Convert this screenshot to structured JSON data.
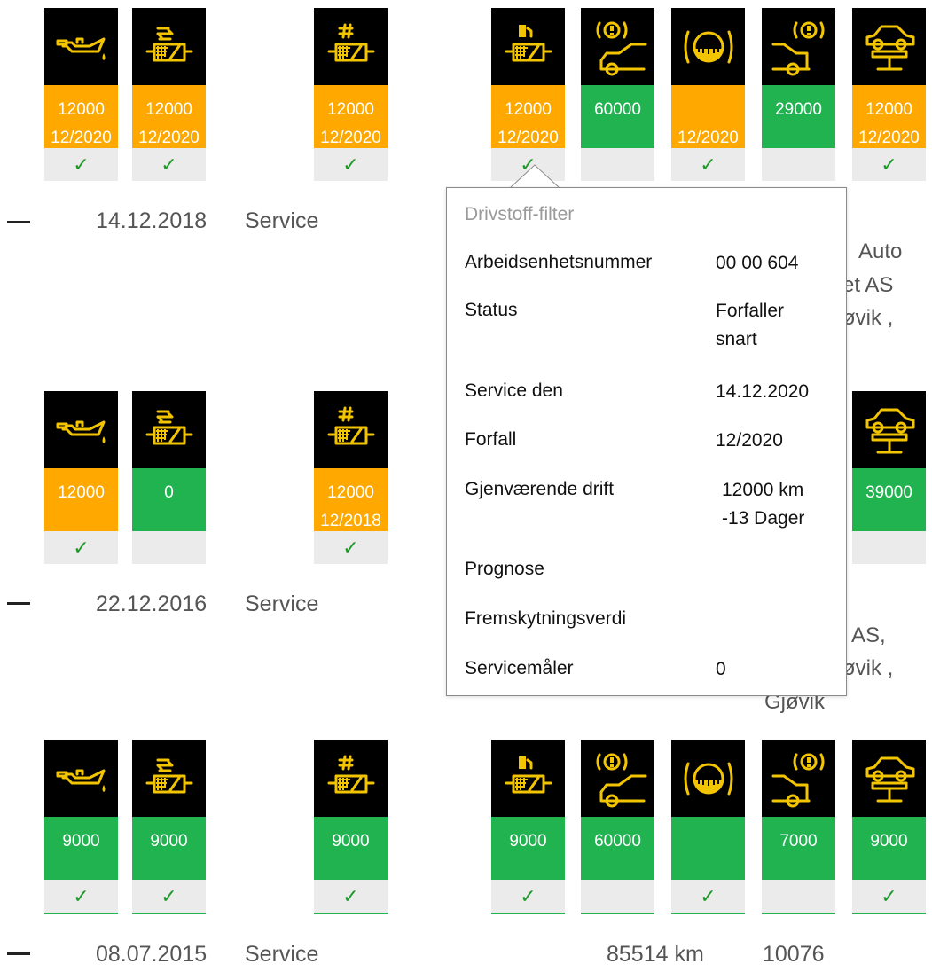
{
  "rows": [
    {
      "date": "14.12.2018",
      "type": "Service",
      "partial_text": [
        "Auto",
        "et AS",
        "øvik ,"
      ],
      "tiles": [
        {
          "icon": "oil-can-icon",
          "status_color": "orange",
          "lines": [
            "12000",
            "12/2020"
          ],
          "checked": true
        },
        {
          "icon": "air-filter-icon",
          "status_color": "orange",
          "lines": [
            "12000",
            "12/2020"
          ],
          "checked": true
        },
        {
          "icon": "pollen-filter-icon",
          "status_color": "orange",
          "lines": [
            "12000",
            "12/2020"
          ],
          "checked": true
        },
        {
          "icon": "fuel-filter-icon",
          "status_color": "orange",
          "lines": [
            "12000",
            "12/2020"
          ],
          "checked": true
        },
        {
          "icon": "front-brake-icon",
          "status_color": "green",
          "lines": [
            "60000",
            ""
          ],
          "checked": false
        },
        {
          "icon": "brake-fluid-icon",
          "status_color": "orange",
          "lines": [
            "",
            "12/2020"
          ],
          "checked": true
        },
        {
          "icon": "rear-brake-icon",
          "status_color": "green",
          "lines": [
            "29000",
            ""
          ],
          "checked": false
        },
        {
          "icon": "vehicle-check-icon",
          "status_color": "orange",
          "lines": [
            "12000",
            "12/2020"
          ],
          "checked": true
        }
      ]
    },
    {
      "date": "22.12.2016",
      "type": "Service",
      "partial_text": [
        "AS,",
        "øvik ,",
        "Gjøvik"
      ],
      "tiles": [
        {
          "icon": "oil-can-icon",
          "status_color": "orange",
          "lines": [
            "12000",
            ""
          ],
          "checked": true
        },
        {
          "icon": "air-filter-icon",
          "status_color": "green",
          "lines": [
            "0",
            ""
          ],
          "checked": false
        },
        {
          "icon": "pollen-filter-icon",
          "status_color": "orange",
          "lines": [
            "12000",
            "12/2018"
          ],
          "checked": true
        },
        {
          "icon": "vehicle-check-icon",
          "status_color": "green",
          "lines": [
            "39000",
            ""
          ],
          "checked": false
        }
      ]
    },
    {
      "date": "08.07.2015",
      "type": "Service",
      "mileage": "85514 km",
      "number": "10076",
      "tiles": [
        {
          "icon": "oil-can-icon",
          "status_color": "green",
          "lines": [
            "9000",
            ""
          ],
          "checked": true
        },
        {
          "icon": "air-filter-icon",
          "status_color": "green",
          "lines": [
            "9000",
            ""
          ],
          "checked": true
        },
        {
          "icon": "pollen-filter-icon",
          "status_color": "green",
          "lines": [
            "9000",
            ""
          ],
          "checked": true
        },
        {
          "icon": "fuel-filter-icon",
          "status_color": "green",
          "lines": [
            "9000",
            ""
          ],
          "checked": true
        },
        {
          "icon": "front-brake-icon",
          "status_color": "green",
          "lines": [
            "60000",
            ""
          ],
          "checked": false
        },
        {
          "icon": "brake-fluid-icon",
          "status_color": "green",
          "lines": [
            "",
            ""
          ],
          "checked": true
        },
        {
          "icon": "rear-brake-icon",
          "status_color": "green",
          "lines": [
            "7000",
            ""
          ],
          "checked": false
        },
        {
          "icon": "vehicle-check-icon",
          "status_color": "green",
          "lines": [
            "9000",
            ""
          ],
          "checked": true
        }
      ]
    }
  ],
  "check_glyph": "✓",
  "popup": {
    "title": "Drivstoff-filter",
    "rows": [
      {
        "label": "Arbeidsenhetsnummer",
        "value": [
          "00 00 604"
        ]
      },
      {
        "label": "Status",
        "value": [
          "Forfaller",
          "snart"
        ]
      },
      {
        "label": "Service den",
        "value": [
          "14.12.2020"
        ]
      },
      {
        "label": "Forfall",
        "value": [
          "12/2020"
        ]
      },
      {
        "label": "Gjenværende drift",
        "value": [
          "12000 km",
          "-13 Dager"
        ]
      },
      {
        "label": "Prognose",
        "value": []
      },
      {
        "label": "Fremskytningsverdi",
        "value": []
      },
      {
        "label": "Servicemåler",
        "value": [
          "0"
        ]
      }
    ]
  },
  "colors": {
    "orange": "#ffa800",
    "green": "#20b350",
    "icon_yellow": "#f2c500",
    "check_green": "#1f9a2a"
  }
}
